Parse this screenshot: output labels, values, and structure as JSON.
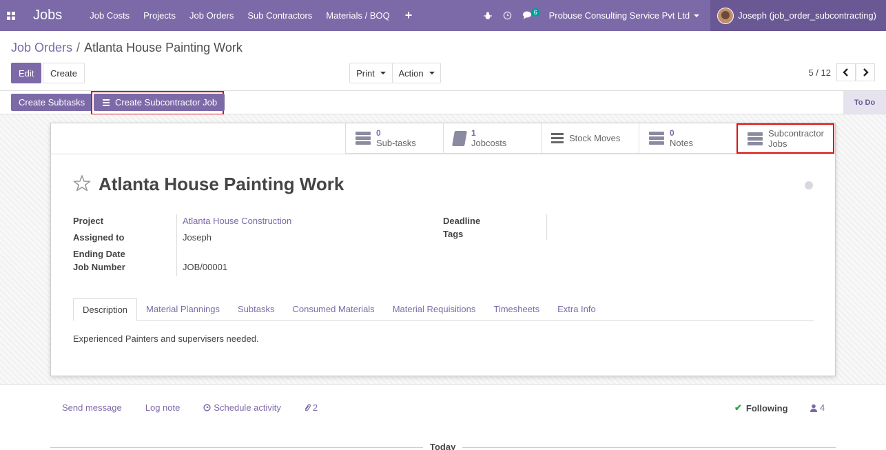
{
  "navbar": {
    "app_title": "Jobs",
    "menu": [
      "Job Costs",
      "Projects",
      "Job Orders",
      "Sub Contractors",
      "Materials / BOQ"
    ],
    "plus_label": "+",
    "chat_badge": "6",
    "company": "Probuse Consulting Service Pvt Ltd",
    "user": "Joseph (job_order_subcontracting)"
  },
  "breadcrumb": {
    "parent": "Job Orders",
    "separator": "/",
    "current": "Atlanta House Painting Work"
  },
  "controls": {
    "edit": "Edit",
    "create": "Create",
    "print": "Print",
    "action": "Action",
    "pager": "5 / 12"
  },
  "statusbar": {
    "create_subtasks": "Create Subtasks",
    "create_subcontractor_job": "Create Subcontractor Job",
    "stage": "To Do"
  },
  "smart_buttons": {
    "subtasks": {
      "value": "0",
      "label": "Sub-tasks"
    },
    "jobcosts": {
      "value": "1",
      "label": "Jobcosts"
    },
    "stock_moves": {
      "label": "Stock Moves"
    },
    "notes": {
      "value": "0",
      "label": "Notes"
    },
    "subcontractor_jobs": {
      "line1": "Subcontractor",
      "line2": "Jobs"
    }
  },
  "record": {
    "title": "Atlanta House Painting Work",
    "fields": {
      "project_label": "Project",
      "project_value": "Atlanta House Construction",
      "assigned_label": "Assigned to",
      "assigned_value": "Joseph",
      "ending_label": "Ending Date",
      "ending_value": "",
      "jobnum_label": "Job Number",
      "jobnum_value": "JOB/00001",
      "deadline_label": "Deadline",
      "tags_label": "Tags"
    }
  },
  "tabs": [
    "Description",
    "Material Plannings",
    "Subtasks",
    "Consumed Materials",
    "Material Requisitions",
    "Timesheets",
    "Extra Info"
  ],
  "description": "Experienced Painters and supervisers needed.",
  "chatter": {
    "send_message": "Send message",
    "log_note": "Log note",
    "schedule_activity": "Schedule activity",
    "attachments": "2",
    "following": "Following",
    "followers": "4",
    "today": "Today"
  },
  "colors": {
    "brand": "#7c6aa8",
    "highlight": "#dd1111"
  },
  "icons": [
    "apps-icon",
    "bug-icon",
    "clock-icon",
    "chat-icon",
    "star-icon",
    "paperclip-icon",
    "user-icon",
    "check-icon",
    "chevron-left-icon",
    "chevron-right-icon"
  ]
}
